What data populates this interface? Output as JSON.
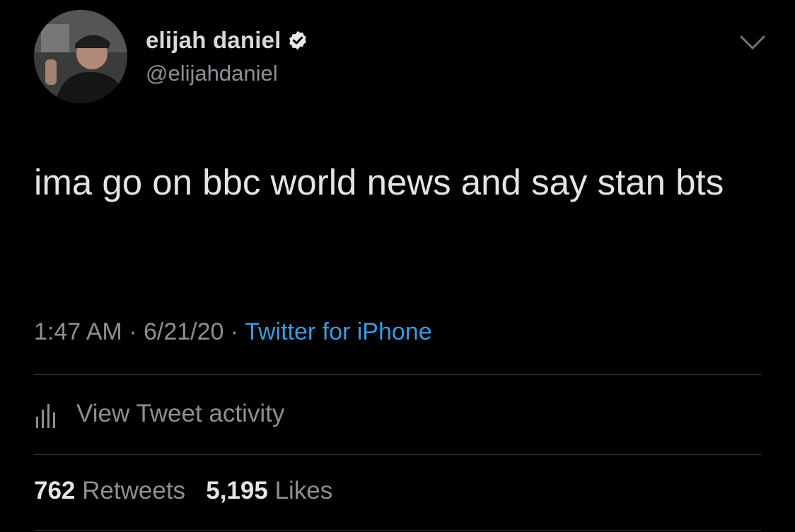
{
  "author": {
    "name": "elijah daniel",
    "handle": "@elijahdaniel",
    "verified": true,
    "avatar_icon": "profile-photo"
  },
  "tweet": {
    "text": "ima go on bbc world news and say stan bts",
    "time": "1:47 AM",
    "date": "6/21/20",
    "separator": "·",
    "source": "Twitter for iPhone"
  },
  "activity": {
    "label": "View Tweet activity",
    "icon": "analytics-bars-icon"
  },
  "stats": {
    "retweets_count": "762",
    "retweets_label": "Retweets",
    "likes_count": "5,195",
    "likes_label": "Likes"
  },
  "colors": {
    "background": "#000000",
    "primary_text": "#e4e4e4",
    "secondary_text": "#8b9095",
    "link": "#3a9be2",
    "divider": "#2f3336"
  }
}
